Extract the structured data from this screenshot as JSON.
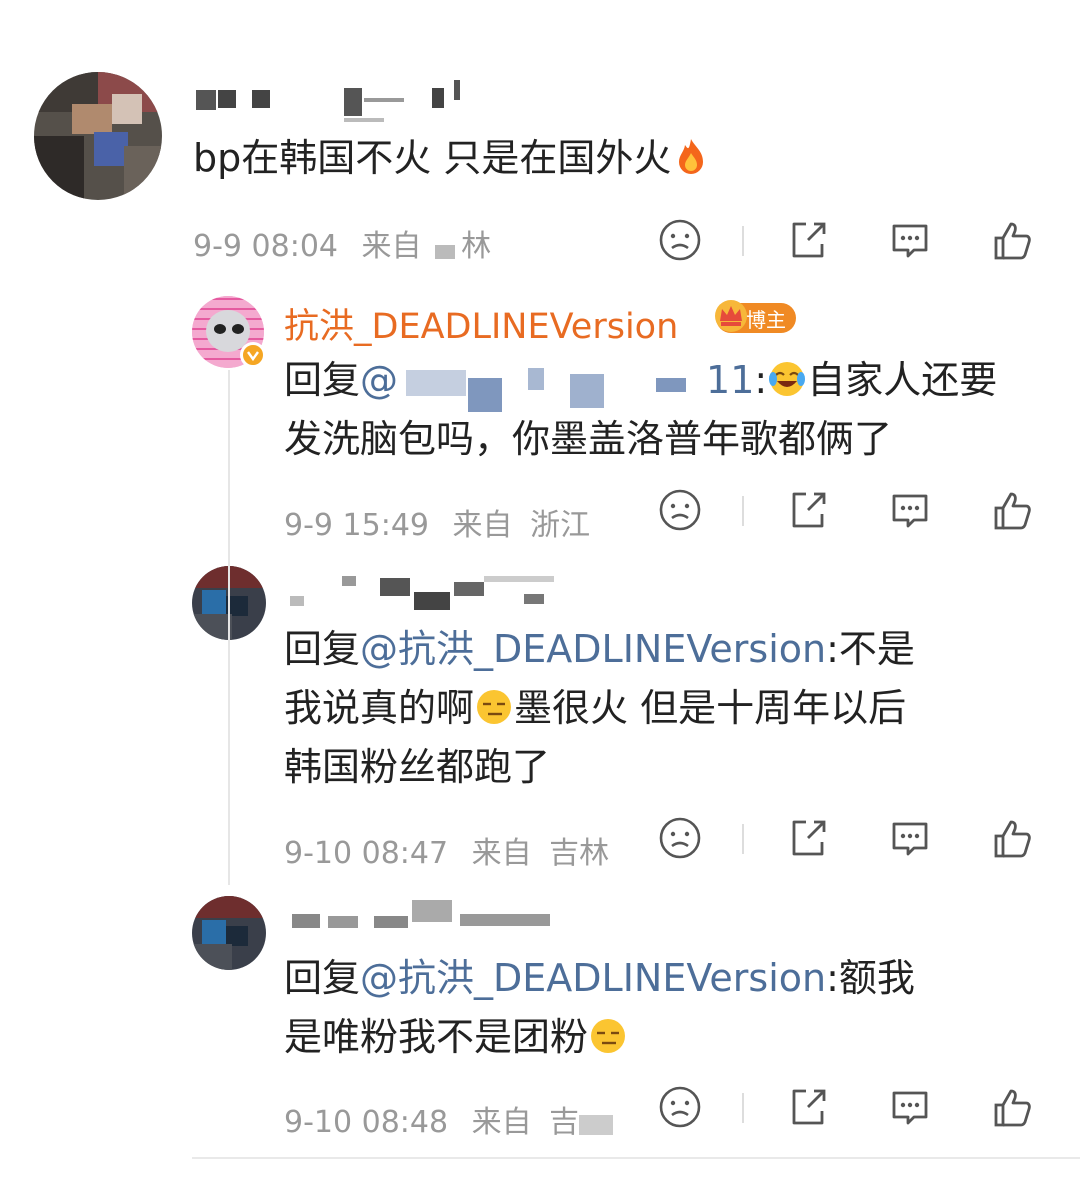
{
  "top_partial_text": "",
  "comments": [
    {
      "id": "main",
      "text": "bp在韩国不火 只是在国外火",
      "emoji": "fire",
      "time": "9-9 08:04",
      "from_label": "来自",
      "location_visible": "林"
    },
    {
      "id": "reply1",
      "username": "抗洪_DEADLINEVersion",
      "badge": "博主",
      "reply_prefix": "回复",
      "mention_visible_start": "@",
      "mention_visible_end": "11",
      "colon": ":",
      "emoji": "laugh-cry",
      "text_line1_after": "自家人还要",
      "text_line2": "发洗脑包吗，你墨盖洛普年歌都俩了",
      "time": "9-9 15:49",
      "from_label": "来自",
      "location": "浙江"
    },
    {
      "id": "reply2",
      "reply_prefix": "回复",
      "mention": "@抗洪_DEADLINEVersion",
      "colon": ":",
      "text_a": "不是",
      "text_b": "我说真的啊",
      "emoji": "squint",
      "text_c": "墨很火 但是十周年以后",
      "text_d": "韩国粉丝都跑了",
      "time": "9-10 08:47",
      "from_label": "来自",
      "location_visible": "吉林"
    },
    {
      "id": "reply3",
      "reply_prefix": "回复",
      "mention": "@抗洪_DEADLINEVersion",
      "colon": ":",
      "text_a": "额我",
      "text_b": "是唯粉我不是团粉",
      "emoji": "squint",
      "time": "9-10 08:48",
      "from_label": "来自",
      "location_visible": "吉"
    }
  ],
  "icons": {
    "dislike": "sad-face-icon",
    "share": "share-icon",
    "comment": "comment-icon",
    "like": "thumbs-up-icon"
  },
  "colors": {
    "username": "#e86b22",
    "mention": "#4d6e99",
    "meta": "#999999",
    "badge": "#f08a24"
  }
}
